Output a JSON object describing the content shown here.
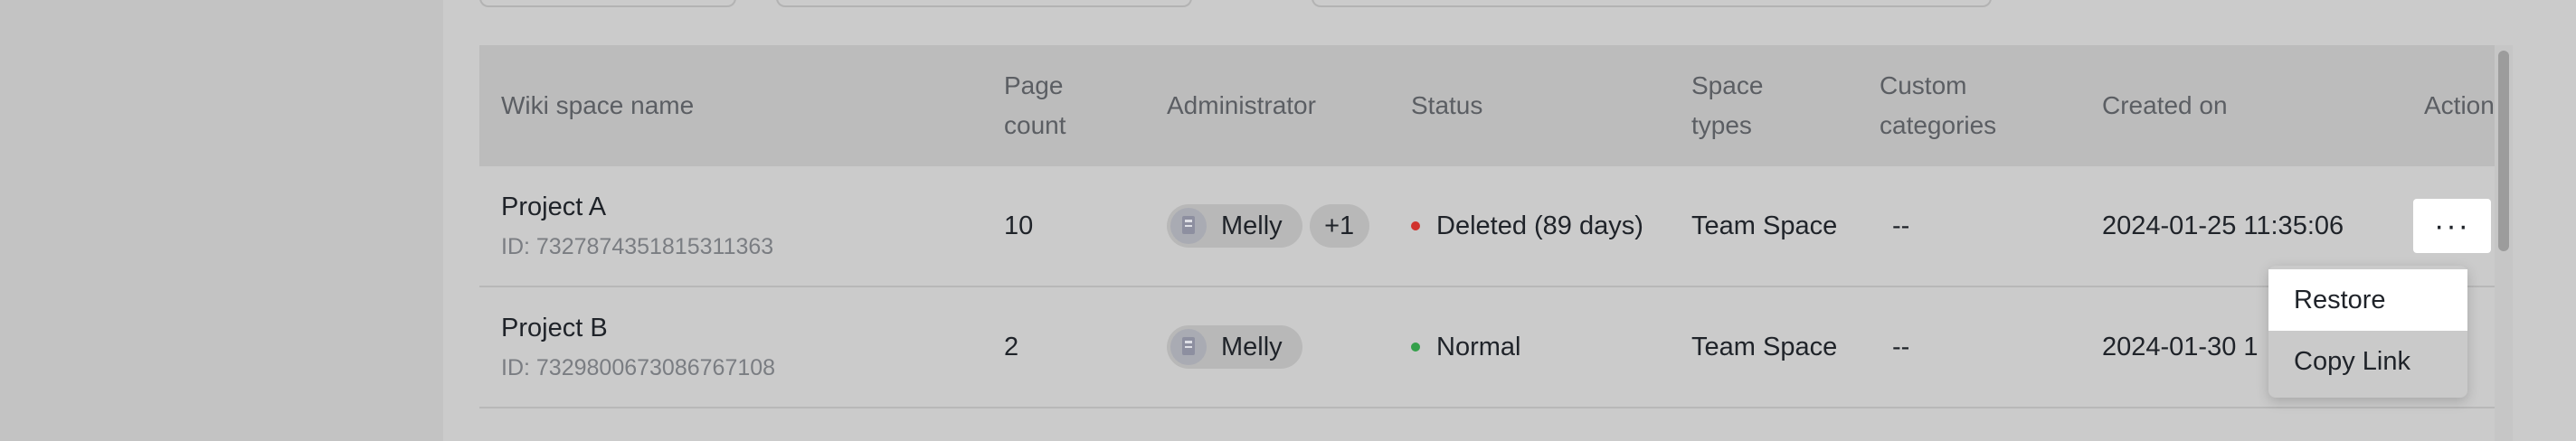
{
  "table": {
    "headers": {
      "name": "Wiki space name",
      "pages_line1": "Page",
      "pages_line2": "count",
      "admin": "Administrator",
      "status": "Status",
      "type_line1": "Space",
      "type_line2": "types",
      "cat_line1": "Custom",
      "cat_line2": "categories",
      "created": "Created on",
      "action": "Action"
    },
    "rows": [
      {
        "name": "Project A",
        "id": "ID: 7327874351815311363",
        "pages": "10",
        "admin": "Melly",
        "admin_extra": "+1",
        "status": "Deleted (89 days)",
        "status_color": "#d1322d",
        "type": "Team Space",
        "categories": "--",
        "created": "2024-01-25 11:35:06",
        "action_icon": "more-icon",
        "action_label": "···"
      },
      {
        "name": "Project B",
        "id": "ID: 7329800673086767108",
        "pages": "2",
        "admin": "Melly",
        "status": "Normal",
        "status_color": "#34a04a",
        "type": "Team Space",
        "categories": "--",
        "created": "2024-01-30 1"
      }
    ]
  },
  "action_menu": {
    "items": [
      {
        "label": "Restore",
        "highlighted": true
      },
      {
        "label": "Copy Link",
        "highlighted": false
      }
    ]
  }
}
